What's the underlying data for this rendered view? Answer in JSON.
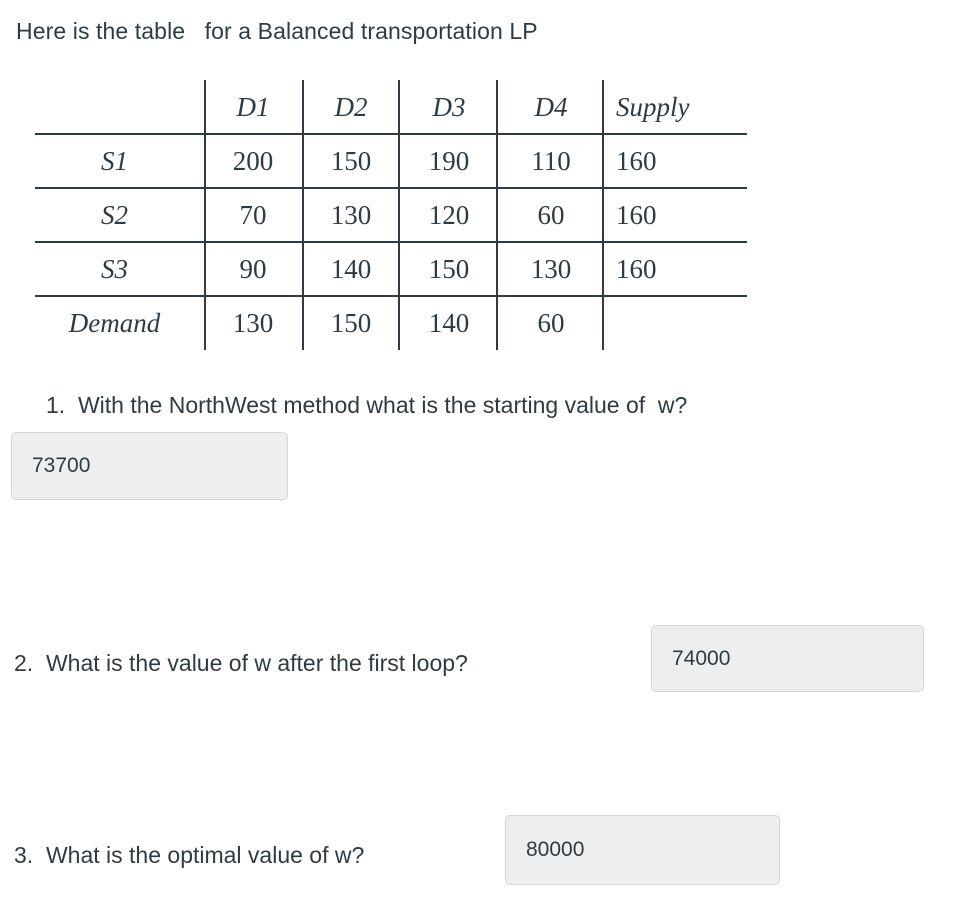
{
  "intro": {
    "text": "Here is the table   for a Balanced transportation LP"
  },
  "table": {
    "corner_label": "",
    "columns": [
      "D1",
      "D2",
      "D3",
      "D4",
      "Supply"
    ],
    "rows": [
      {
        "label": "S1",
        "cells": [
          "200",
          "150",
          "190",
          "110"
        ],
        "supply": "160"
      },
      {
        "label": "S2",
        "cells": [
          "70",
          "130",
          "120",
          "60"
        ],
        "supply": "160"
      },
      {
        "label": "S3",
        "cells": [
          "90",
          "140",
          "150",
          "130"
        ],
        "supply": "160"
      }
    ],
    "demand": {
      "label": "Demand",
      "cells": [
        "130",
        "150",
        "140",
        "60"
      ],
      "supply": ""
    }
  },
  "questions": [
    {
      "number": "1.",
      "text": "With the NorthWest method what is the starting value of  w?",
      "full": "1.  With the NorthWest method what is the starting value of  w?",
      "answer": "73700"
    },
    {
      "number": "2.",
      "text": "What is the value of w after the first loop?",
      "full": "2.  What is the value of w after the first loop?",
      "answer": "74000"
    },
    {
      "number": "3.",
      "text": "What is the optimal value of w?",
      "full": "3.  What is the optimal value of w?",
      "answer": "80000"
    }
  ],
  "colors": {
    "text": "#2d3b45",
    "rule": "#2d3b45",
    "input_background": "#eeeeee",
    "input_border": "#d4d7da",
    "page_background": "#ffffff"
  }
}
